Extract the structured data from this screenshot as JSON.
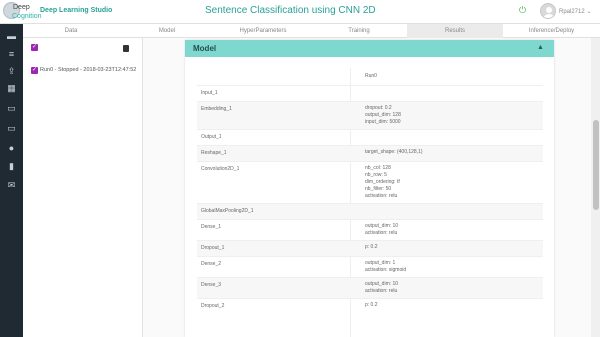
{
  "app": {
    "logo_line1": "Deep",
    "logo_line2": "Cognition",
    "name": "Deep Learning Studio",
    "page_title": "Sentence Classification using CNN 2D",
    "user": "Rpal2712 ⌄"
  },
  "sidebar": {
    "icons": [
      "folder-icon",
      "database-icon",
      "upload-icon",
      "grid-icon",
      "folder-open-icon",
      "laptop-icon",
      "chat-icon",
      "book-icon",
      "mail-icon"
    ]
  },
  "tabs": [
    {
      "label": "Data"
    },
    {
      "label": "Model"
    },
    {
      "label": "HyperParameters"
    },
    {
      "label": "Training"
    },
    {
      "label": "Results"
    },
    {
      "label": "Inference/Deploy"
    }
  ],
  "runs": {
    "item": "Run0 - Stopped - 2018-03-23T12:47:52"
  },
  "model_card": {
    "title": "Model",
    "column_header": "Run0",
    "rows": [
      {
        "layer": "Input_1",
        "params": []
      },
      {
        "layer": "Embedding_1",
        "params": [
          "dropout: 0.2",
          "output_dim: 128",
          "input_dim: 5000"
        ]
      },
      {
        "layer": "Output_1",
        "params": []
      },
      {
        "layer": "Reshape_1",
        "params": [
          "target_shape: (400,128,1)"
        ]
      },
      {
        "layer": "Convolution2D_1",
        "params": [
          "nb_col: 128",
          "nb_row: 5",
          "dim_ordering: tf",
          "nb_filter: 50",
          "activation: relu"
        ]
      },
      {
        "layer": "GlobalMaxPooling2D_1",
        "params": []
      },
      {
        "layer": "Dense_1",
        "params": [
          "output_dim: 10",
          "activation: relu"
        ]
      },
      {
        "layer": "Dropout_1",
        "params": [
          "p: 0.2"
        ]
      },
      {
        "layer": "Dense_2",
        "params": [
          "output_dim: 1",
          "activation: sigmoid"
        ]
      },
      {
        "layer": "Dense_3",
        "params": [
          "output_dim: 10",
          "activation: relu"
        ]
      },
      {
        "layer": "Dropout_2",
        "params": [
          "p: 0.2"
        ]
      }
    ]
  },
  "colors": {
    "accent": "#2aa198",
    "card_header": "#7fd8cf",
    "checkbox": "#9c27b0",
    "sidebar": "#1f2a33"
  }
}
